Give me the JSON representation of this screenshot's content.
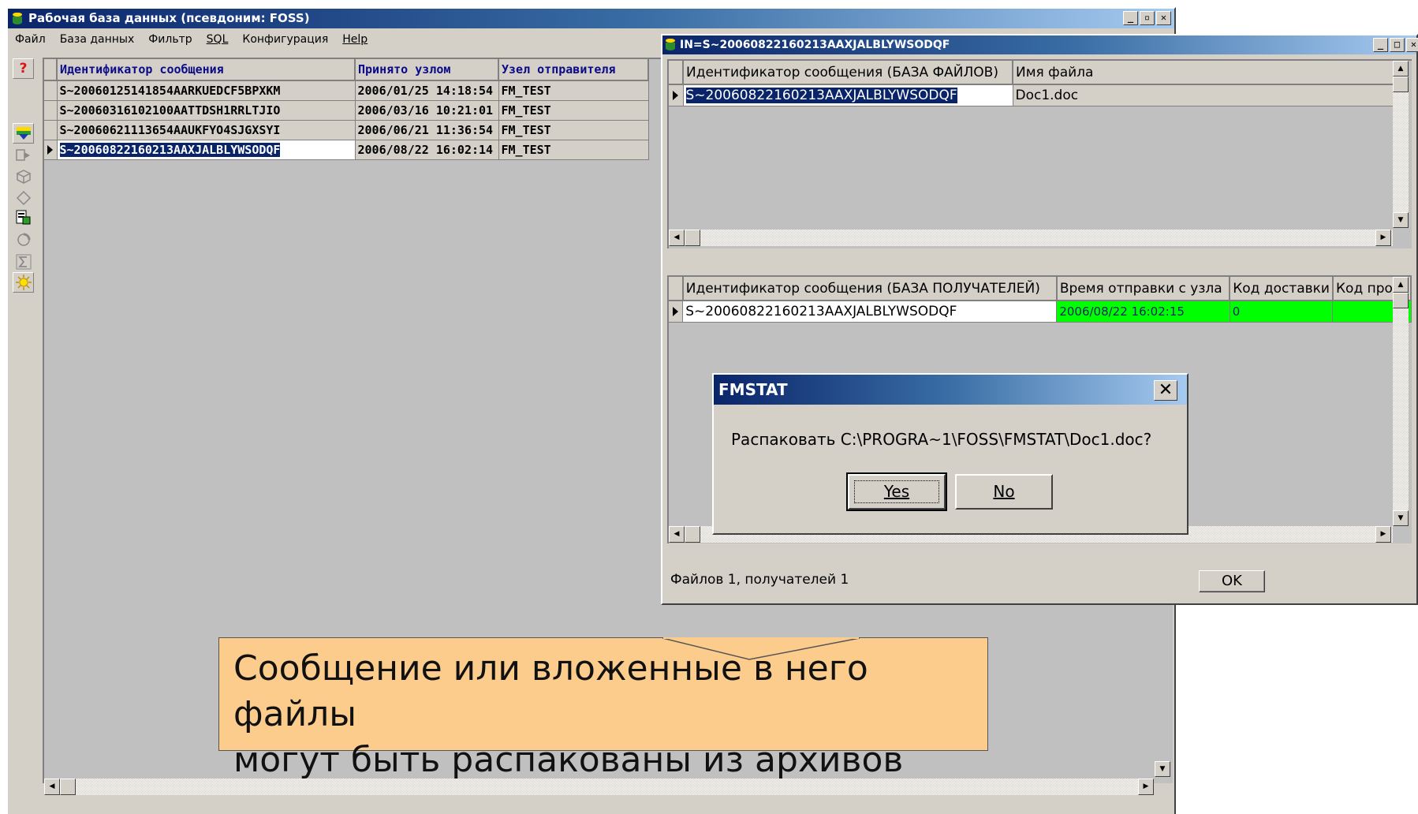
{
  "main_window": {
    "title": "Рабочая база данных (псевдоним: FOSS)",
    "caption_buttons": [
      "_",
      "🗗",
      "✕"
    ],
    "menu": [
      {
        "label": "Файл"
      },
      {
        "label": "База данных"
      },
      {
        "label": "Фильтр"
      },
      {
        "label": "SQL",
        "underline": true
      },
      {
        "label": "Конфигурация"
      },
      {
        "label": "Help",
        "underline": true
      }
    ],
    "toolbar": [
      "help-icon",
      "download-icon",
      "forward-icon",
      "box-icon",
      "eraser-icon",
      "import-icon",
      "refresh-icon",
      "sum-icon",
      "sun-icon"
    ],
    "grid": {
      "columns": [
        "Идентификатор сообщения",
        "Принято узлом",
        "Узел отправителя"
      ],
      "rows": [
        [
          "S~20060125141854AARKUEDCF5BPXKM",
          "2006/01/25 14:18:54",
          "FM_TEST"
        ],
        [
          "S~20060316102100AATTDSH1RRLTJIO",
          "2006/03/16 10:21:01",
          "FM_TEST"
        ],
        [
          "S~20060621113654AAUKFYO4SJGXSYI",
          "2006/06/21 11:36:54",
          "FM_TEST"
        ],
        [
          "S~20060822160213AAXJALBLYWSODQF",
          "2006/08/22 16:02:14",
          "FM_TEST"
        ]
      ],
      "selected_row": 3
    }
  },
  "child_window": {
    "title": "IN=S~20060822160213AAXJALBLYWSODQF",
    "files_grid": {
      "columns": [
        "Идентификатор сообщения (БАЗА ФАЙЛОВ)",
        "Имя файла"
      ],
      "rows": [
        [
          "S~20060822160213AAXJALBLYWSODQF",
          "Doc1.doc"
        ]
      ]
    },
    "recipients_grid": {
      "columns": [
        "Идентификатор сообщения (БАЗА ПОЛУЧАТЕЛЕЙ)",
        "Время отправки с узла",
        "Код доставки",
        "Код проч"
      ],
      "rows": [
        [
          "S~20060822160213AAXJALBLYWSODQF",
          "2006/08/22 16:02:15",
          "0",
          ""
        ]
      ]
    },
    "status": "Файлов 1, получателей 1",
    "ok_label": "OK"
  },
  "dialog": {
    "title": "FMSTAT",
    "message": "Распаковать C:\\PROGRA~1\\FOSS\\FMSTAT\\Doc1.doc?",
    "yes_label": "Yes",
    "no_label": "No"
  },
  "callout": {
    "line1": "Сообщение или вложенные в него файлы",
    "line2": "могут быть распакованы из архивов"
  },
  "colors": {
    "titlebar_start": "#0a246a",
    "titlebar_end": "#a6caf0",
    "window_bg": "#d4d0c8",
    "highlight": "#00ff00",
    "callout_bg": "#fccc8c"
  }
}
